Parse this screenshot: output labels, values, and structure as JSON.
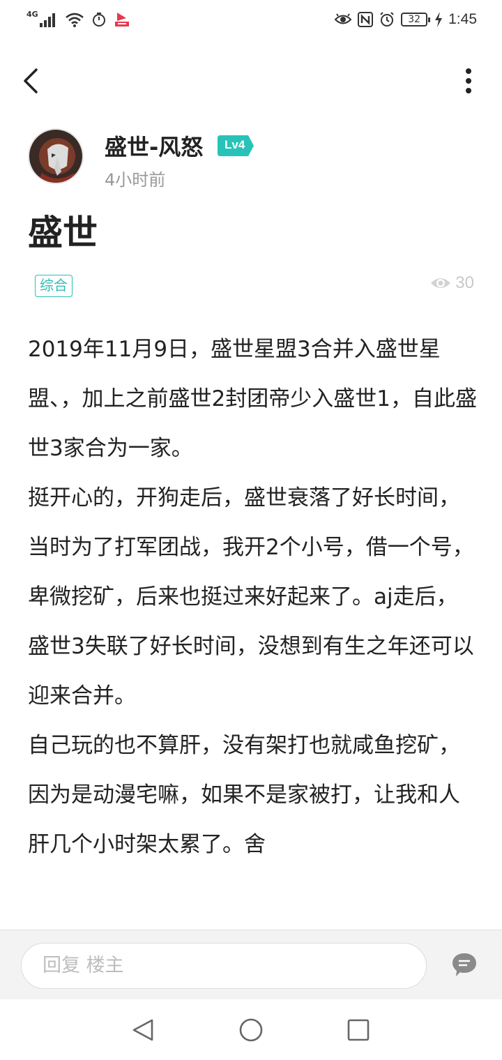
{
  "status_bar": {
    "network": "4G",
    "battery": "32",
    "time": "1:45"
  },
  "author": {
    "name": "盛世-风怒",
    "level": "Lv4",
    "time_ago": "4小时前"
  },
  "post": {
    "title": "盛世",
    "tag": "综合",
    "views": "30",
    "paragraphs": [
      "2019年11月9日，盛世星盟3合并入盛世星盟、，加上之前盛世2封团帝少入盛世1，自此盛世3家合为一家。",
      "挺开心的，开狗走后，盛世衰落了好长时间，当时为了打军团战，我开2个小号，借一个号，卑微挖矿，后来也挺过来好起来了。aj走后，盛世3失联了好长时间，没想到有生之年还可以迎来合并。",
      "自己玩的也不算肝，没有架打也就咸鱼挖矿，因为是动漫宅嘛，如果不是家被打，让我和人肝几个小时架太累了。舍"
    ]
  },
  "reply": {
    "placeholder": "回复  楼主"
  },
  "icons": {
    "back": "back-arrow-icon",
    "more": "more-vertical-icon",
    "views": "eye-icon",
    "reply": "comment-icon"
  },
  "colors": {
    "accent": "#2bbfb4",
    "badge": "#27c3b8",
    "muted": "#999999"
  }
}
